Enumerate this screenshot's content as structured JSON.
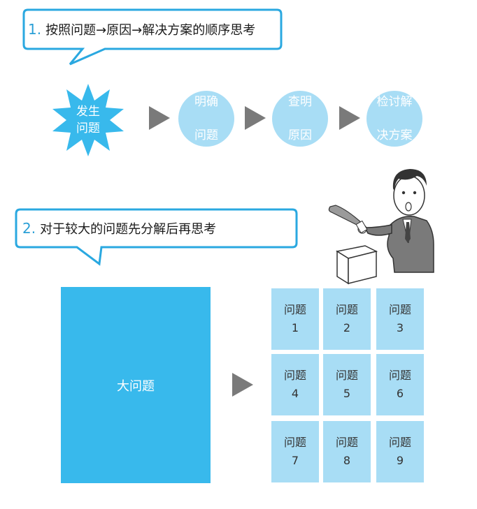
{
  "callout1": {
    "number": "1.",
    "text": "按照问题→原因→解决方案的顺序思考"
  },
  "callout2": {
    "number": "2.",
    "text": "对于较大的问题先分解后再思考"
  },
  "flow": {
    "start": {
      "line1": "发生",
      "line2": "问题"
    },
    "steps": [
      {
        "line1": "明确",
        "line2": "问题"
      },
      {
        "line1": "查明",
        "line2": "原因"
      },
      {
        "line1": "检讨解",
        "line2": "决方案"
      }
    ]
  },
  "big_problem": "大问题",
  "sub_problems": [
    {
      "label": "问题",
      "num": "1"
    },
    {
      "label": "问题",
      "num": "2"
    },
    {
      "label": "问题",
      "num": "3"
    },
    {
      "label": "问题",
      "num": "4"
    },
    {
      "label": "问题",
      "num": "5"
    },
    {
      "label": "问题",
      "num": "6"
    },
    {
      "label": "问题",
      "num": "7"
    },
    {
      "label": "问题",
      "num": "8"
    },
    {
      "label": "问题",
      "num": "9"
    }
  ],
  "colors": {
    "accent_blue": "#38b9ec",
    "light_blue": "#a8ddf5",
    "callout_border": "#2aa8e0",
    "arrow_gray": "#7a7a7a"
  },
  "icons": [
    "arrow-right-icon",
    "starburst-icon",
    "businessman-cutting-box-illustration"
  ]
}
